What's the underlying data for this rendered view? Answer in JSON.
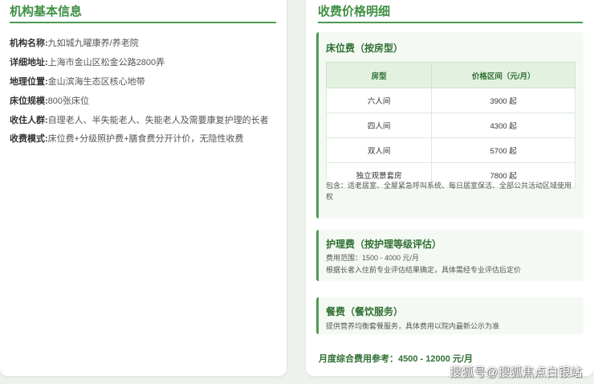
{
  "left_section": {
    "title": "机构基本信息",
    "items": [
      {
        "label": "机构名称:",
        "value": "九如城九曜康养/养老院"
      },
      {
        "label": "详细地址:",
        "value": "上海市金山区松金公路2800弄"
      },
      {
        "label": "地理位置:",
        "value": "金山滨海生态区核心地带"
      },
      {
        "label": "床位规模:",
        "value": "800张床位"
      },
      {
        "label": "收住人群:",
        "value": "自理老人、半失能老人、失能老人及需要康复护理的长者"
      },
      {
        "label": "收费模式:",
        "value": "床位费+分级照护费+膳食费分开计价，无隐性收费"
      }
    ]
  },
  "right_section": {
    "title": "收费价格明细",
    "bed_fee": {
      "title": "床位费（按房型）",
      "table": {
        "headers": [
          "房型",
          "价格区间（元/月）"
        ],
        "rows": [
          [
            "六人间",
            "3900 起"
          ],
          [
            "四人间",
            "4300 起"
          ],
          [
            "双人间",
            "5700 起"
          ],
          [
            "独立观景套房",
            "7800 起"
          ]
        ]
      },
      "note": "包含：适老居室、全屋紧急呼叫系统、每日居室保洁、全部公共活动区域使用权"
    },
    "care_fee": {
      "title": "护理费（按护理等级评估）",
      "range": "费用范围：1500 - 4000 元/月",
      "desc": "根据长者入住前专业评估结果确定，具体需经专业评估后定价"
    },
    "meal_fee": {
      "title": "餐费（餐饮服务）",
      "desc": "提供营养均衡套餐服务，具体费用以院内最新公示为准"
    },
    "total": "月度综合费用参考：4500 - 12000 元/月"
  },
  "watermark": "搜狐号@搜狐焦点白银站",
  "colors": {
    "accent": "#3f8f43",
    "card_bg": "#f4faf3",
    "header_bg": "#e3f1e1",
    "page_bg": "#eef2ec"
  }
}
